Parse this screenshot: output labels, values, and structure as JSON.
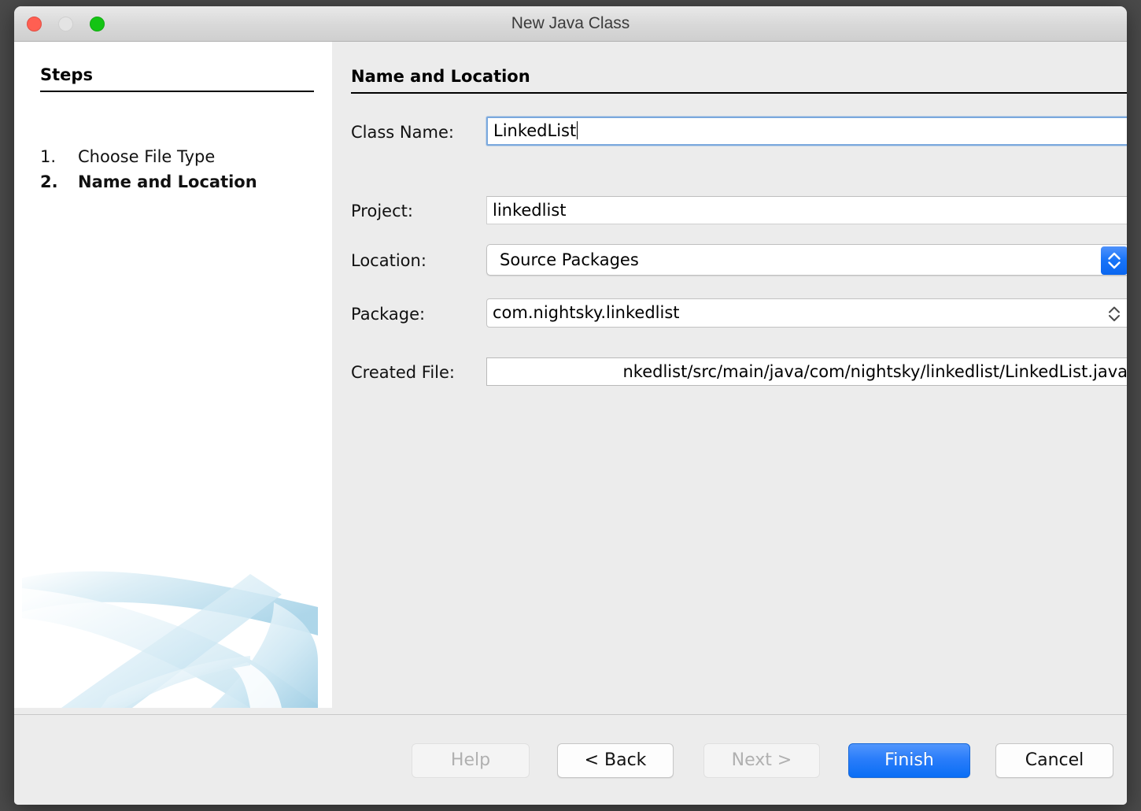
{
  "window": {
    "title": "New Java Class",
    "traffic_lights": [
      "close",
      "minimize",
      "maximize"
    ]
  },
  "sidebar": {
    "heading": "Steps",
    "steps": [
      {
        "num": "1.",
        "label": "Choose File Type",
        "current": false
      },
      {
        "num": "2.",
        "label": "Name and Location",
        "current": true
      }
    ]
  },
  "panel": {
    "title": "Name and Location",
    "fields": [
      {
        "label": "Class Name:",
        "value": "LinkedList",
        "kind": "textfield-focused"
      },
      {
        "label": "Project:",
        "value": "linkedlist",
        "kind": "textfield-readonly"
      },
      {
        "label": "Location:",
        "value": "Source Packages",
        "kind": "combobox-popup"
      },
      {
        "label": "Package:",
        "value": "com.nightsky.linkedlist",
        "kind": "combobox-editable"
      },
      {
        "label": "Created File:",
        "value": "nkedlist/src/main/java/com/nightsky/linkedlist/LinkedList.java",
        "kind": "textfield-readonly-scrolled"
      }
    ]
  },
  "footer": {
    "buttons": [
      {
        "label": "Help",
        "state": "disabled"
      },
      {
        "label": "< Back",
        "state": "enabled"
      },
      {
        "label": "Next >",
        "state": "disabled"
      },
      {
        "label": "Finish",
        "state": "default"
      },
      {
        "label": "Cancel",
        "state": "enabled"
      }
    ]
  },
  "colors": {
    "window_bg": "#ececec",
    "sidebar_bg": "#ffffff",
    "titlebar_top": "#e9e9e9",
    "titlebar_bottom": "#cfcfcf",
    "close": "#ff5f52",
    "minimize": "#e4e4e4",
    "maximize": "#14c414",
    "accent_blue": "#0a6ef5",
    "focus_ring": "#7aa8dd",
    "artwork_blue": "#b7dcec"
  }
}
